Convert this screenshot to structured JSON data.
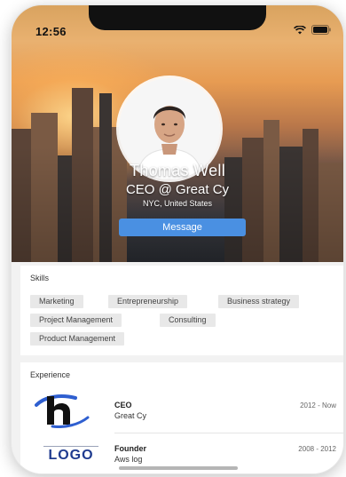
{
  "status_bar": {
    "time": "12:56"
  },
  "profile": {
    "name": "Thomas Well",
    "title": "CEO @ Great Cy",
    "location": "NYC, United States",
    "message_button": "Message"
  },
  "skills": {
    "heading": "Skills",
    "items": [
      "Marketing",
      "Entrepreneurship",
      "Business strategy",
      "Project Management",
      "Consulting",
      "Product Management"
    ]
  },
  "experience": {
    "heading": "Experience",
    "items": [
      {
        "role": "CEO",
        "company": "Great Cy",
        "years": "2012 - Now",
        "logo": "h-logo"
      },
      {
        "role": "Founder",
        "company": "Aws log",
        "years": "2008 - 2012",
        "logo": "logo-wordmark",
        "logo_text": "LOGO"
      }
    ]
  },
  "colors": {
    "accent": "#4a90e2",
    "chip_bg": "#e8e8e8",
    "logo_blue": "#1f3b8f"
  }
}
